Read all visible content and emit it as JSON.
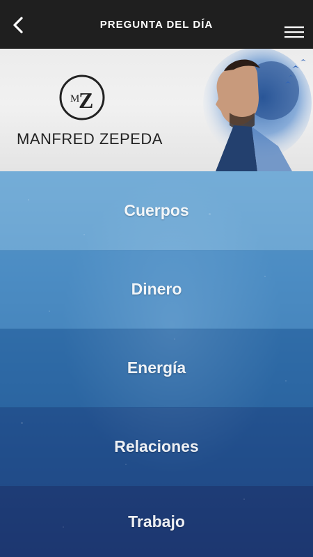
{
  "navbar": {
    "title": "PREGUNTA DEL DÍA",
    "back_icon": "chevron-left-icon",
    "menu_icon": "hamburger-menu-icon"
  },
  "banner": {
    "logo_letters": "MZ",
    "brand_name": "MANFRED ZEPEDA"
  },
  "categories": [
    {
      "label": "Cuerpos",
      "color": "#78aed7"
    },
    {
      "label": "Dinero",
      "color": "#4d8dc4"
    },
    {
      "label": "Energía",
      "color": "#2e6aa5"
    },
    {
      "label": "Relaciones",
      "color": "#234f8c"
    },
    {
      "label": "Trabajo",
      "color": "#1e3a73"
    }
  ],
  "colors": {
    "navbar": "#1f1f1f",
    "banner": "#ececec",
    "text": "#ffffff"
  }
}
